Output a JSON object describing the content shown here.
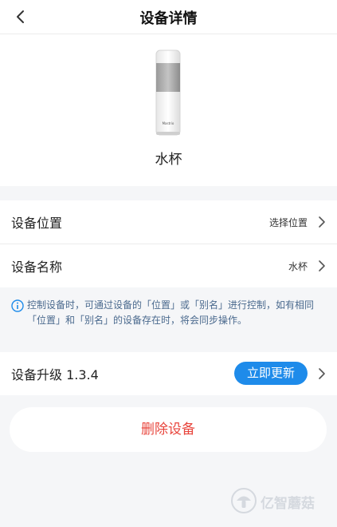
{
  "header": {
    "title": "设备详情",
    "back_icon": "chevron-left-icon"
  },
  "device": {
    "name": "水杯",
    "brand_text": "Mastrio"
  },
  "rows": {
    "location": {
      "label": "设备位置",
      "value": "选择位置"
    },
    "name": {
      "label": "设备名称",
      "value": "水杯"
    }
  },
  "notice": {
    "icon": "info-icon",
    "text": "控制设备时，可通过设备的「位置」或「别名」进行控制，如有相同「位置」和「别名」的设备存在时，将会同步操作。"
  },
  "upgrade": {
    "label": "设备升级 1.3.4",
    "button": "立即更新"
  },
  "delete": {
    "label": "删除设备"
  },
  "watermark": {
    "text": "亿智蘑菇"
  },
  "colors": {
    "accent": "#1e8bea",
    "danger": "#e8453c",
    "notice_text": "#4b6a8e",
    "background": "#f5f6f8"
  }
}
